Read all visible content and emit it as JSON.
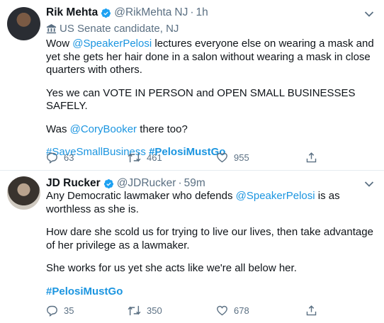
{
  "tweets": [
    {
      "author": "Rik Mehta",
      "handle": "@RikMehta",
      "location": "NJ",
      "time": "1h",
      "label": "US Senate candidate, NJ",
      "text": {
        "p1_a": "Wow ",
        "p1_mention": "@SpeakerPelosi",
        "p1_b": " lectures everyone else on wearing a mask and yet she gets her hair done in a salon without wearing a mask in close quarters with others.",
        "p2": "Yes we can VOTE IN PERSON and OPEN SMALL BUSINESSES SAFELY.",
        "p3_a": "Was ",
        "p3_mention": "@CoryBooker",
        "p3_b": " there too?",
        "hashtag1": "#SaveSmallBusiness",
        "hashtag2": "#PelosiMustGo"
      },
      "replies": "63",
      "retweets": "461",
      "likes": "955"
    },
    {
      "author": "JD Rucker",
      "handle": "@JDRucker",
      "time": "59m",
      "text": {
        "p1_a": "Any Democratic lawmaker who defends ",
        "p1_mention": "@SpeakerPelosi",
        "p1_b": " is as worthless as she is.",
        "p2": "How dare she scold us for trying to live our lives, then take advantage of her privilege as a lawmaker.",
        "p3": "She works for us yet she acts like we're all below her.",
        "hashtag1": "#PelosiMustGo"
      },
      "replies": "35",
      "retweets": "350",
      "likes": "678"
    }
  ],
  "colors": {
    "link": "#1b95e0",
    "secondary_text": "#5b7083",
    "verified": "#1da1f2"
  },
  "icons": {
    "verified": "verified-badge-icon",
    "reply": "reply-icon",
    "retweet": "retweet-icon",
    "like": "heart-icon",
    "share": "share-icon",
    "more": "chevron-down-icon",
    "label": "government-building-icon"
  }
}
